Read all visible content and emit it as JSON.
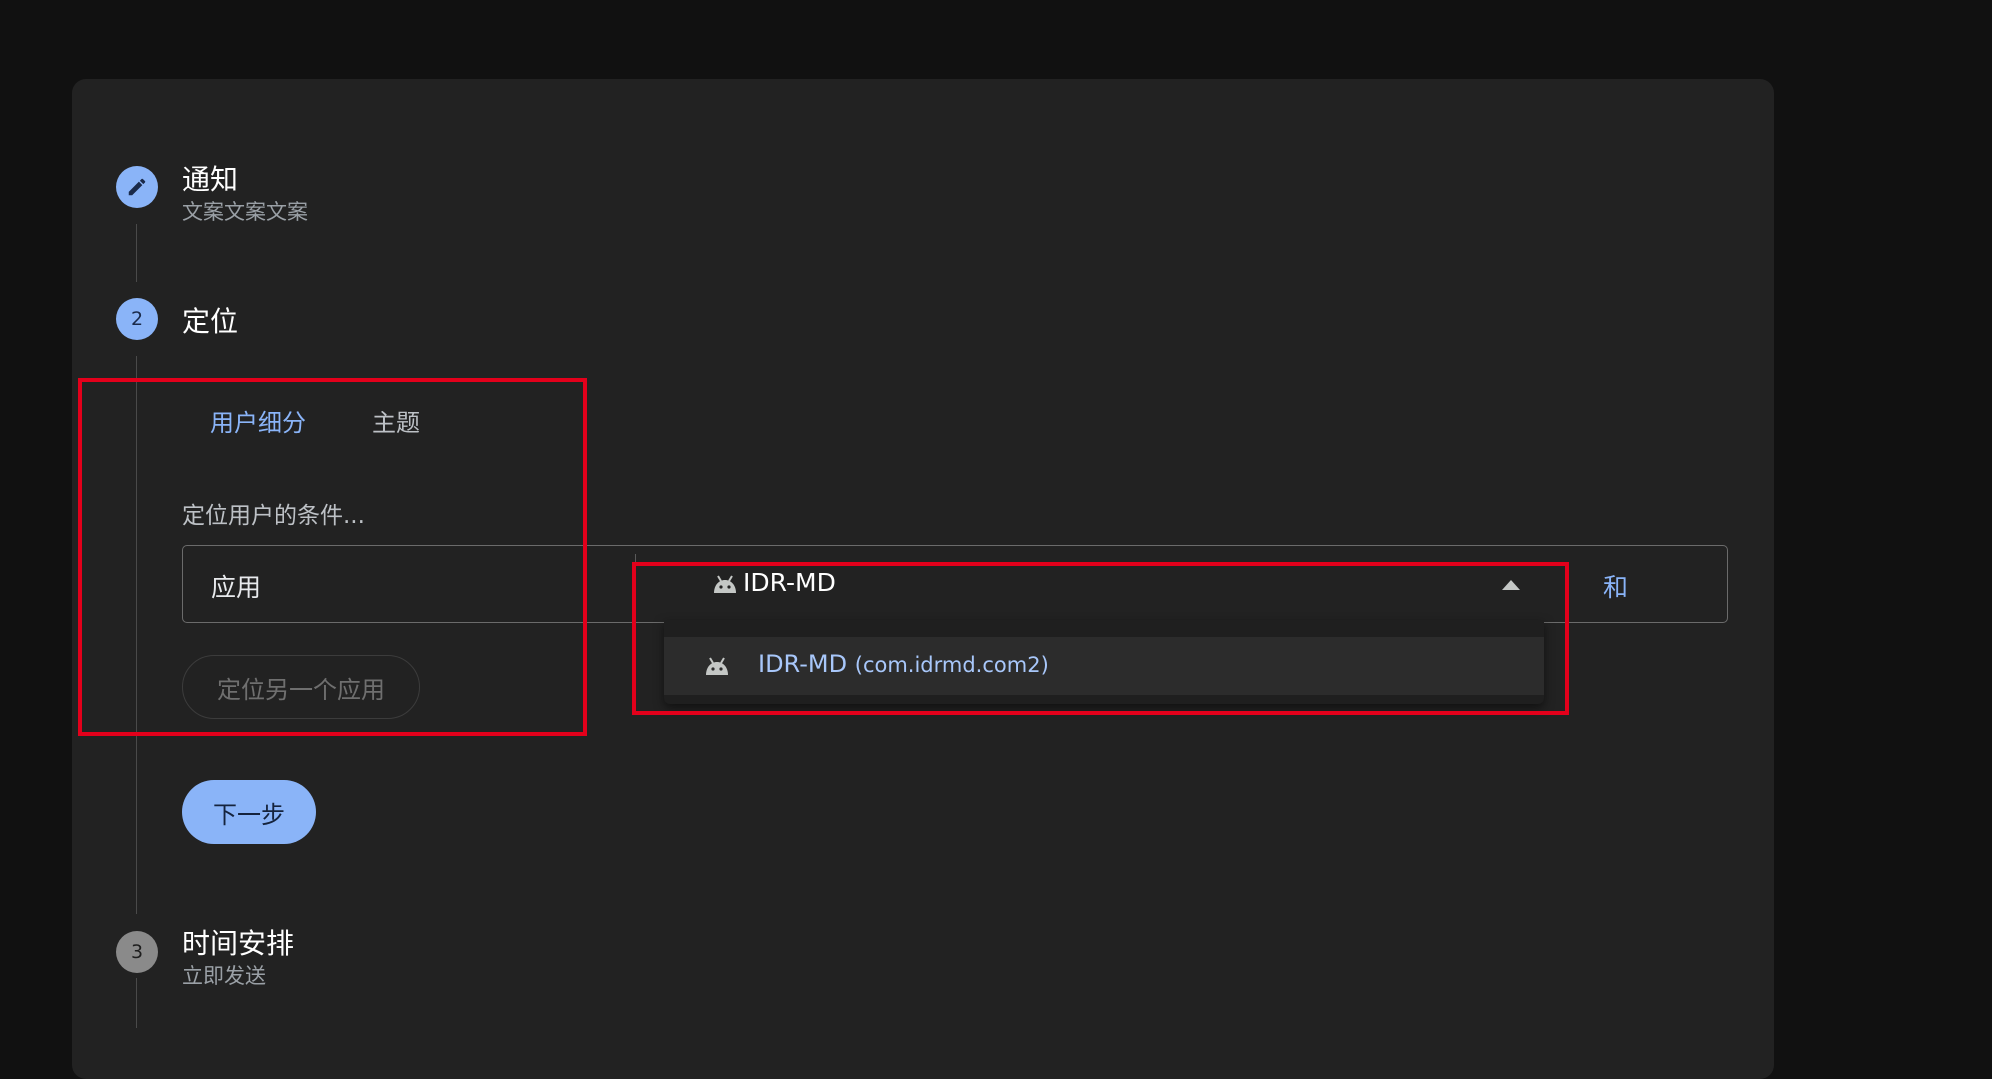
{
  "steps": [
    {
      "indicator": "",
      "title": "通知",
      "subtitle": "文案文案文案",
      "state": "completed-editable"
    },
    {
      "indicator": "2",
      "title": "定位",
      "subtitle": "",
      "state": "active"
    },
    {
      "indicator": "3",
      "title": "时间安排",
      "subtitle": "立即发送",
      "state": "inactive"
    }
  ],
  "targeting": {
    "tabs": [
      {
        "label": "用户细分",
        "selected": true
      },
      {
        "label": "主题",
        "selected": false
      }
    ],
    "condition_label": "定位用户的条件...",
    "row": {
      "key": "应用",
      "selected_value": "IDR-MD",
      "and_label": "和"
    },
    "dropdown_options": [
      {
        "name": "IDR-MD",
        "package": "(com.idrmd.com2)"
      }
    ],
    "another_app_label": "定位另一个应用",
    "next_label": "下一步"
  },
  "colors": {
    "accent": "#8ab4f8",
    "highlight": "#e3001b",
    "card": "#222222",
    "background": "#111111"
  },
  "icons": {
    "step1": "pencil-icon",
    "app": "android-icon",
    "select_toggle": "caret-up-icon"
  }
}
